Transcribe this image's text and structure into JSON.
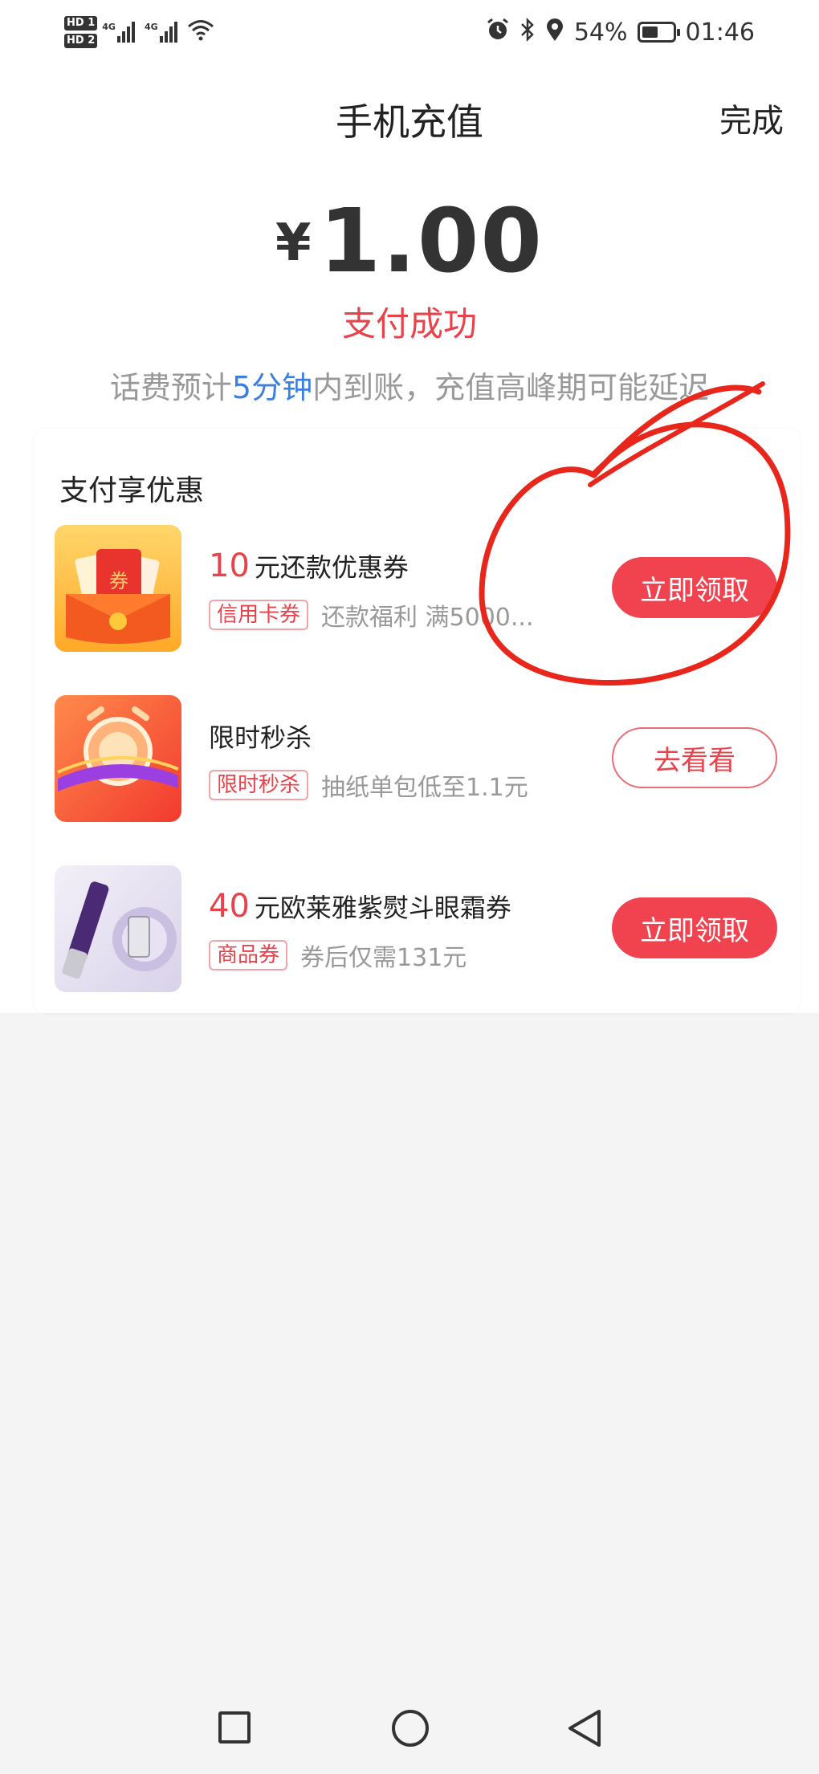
{
  "status_bar": {
    "hd1": "HD 1",
    "hd2": "HD 2",
    "net1": "4G",
    "net2": "4G",
    "battery_pct": "54%",
    "battery_level": 0.54,
    "time": "01:46",
    "icons": [
      "alarm-icon",
      "bluetooth-icon",
      "location-icon",
      "wifi-icon"
    ]
  },
  "header": {
    "title": "手机充值",
    "done": "完成"
  },
  "payment": {
    "currency": "¥",
    "amount": "1.00",
    "status": "支付成功",
    "note_prefix": "话费预计",
    "note_highlight": "5分钟",
    "note_suffix": "内到账，充值高峰期可能延迟"
  },
  "offers_section": {
    "title": "支付享优惠",
    "items": [
      {
        "value": "10",
        "title": "元还款优惠券",
        "tag": "信用卡券",
        "desc": "还款福利 满5000...",
        "button": "立即领取",
        "icon": "red-envelope-coupon-icon"
      },
      {
        "value": "",
        "title": "限时秒杀",
        "tag": "限时秒杀",
        "desc": "抽纸单包低至1.1元",
        "button": "去看看",
        "icon": "flash-sale-alarm-icon"
      },
      {
        "value": "40",
        "title": "元欧莱雅紫熨斗眼霜券",
        "tag": "商品券",
        "desc": "券后仅需131元",
        "button": "立即领取",
        "icon": "eye-cream-product-icon"
      }
    ]
  },
  "colors": {
    "accent_red": "#f0434f",
    "highlight_blue": "#3d7fe0",
    "annotation_red": "#e8261b"
  }
}
